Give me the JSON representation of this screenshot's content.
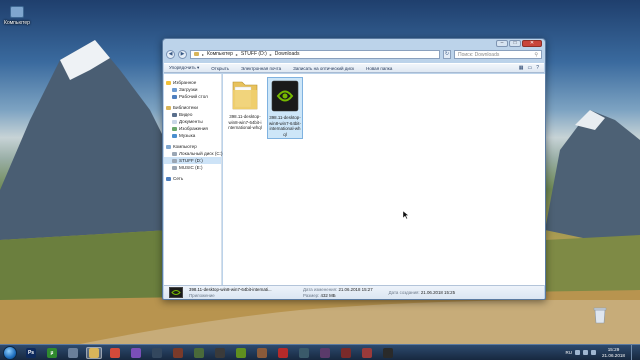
{
  "desktop": {
    "icons": [
      {
        "label": "Компьютер",
        "icon": "computer-icon"
      }
    ],
    "recycle_bin": {
      "icon": "recycle-bin-icon"
    }
  },
  "window": {
    "breadcrumbs": [
      "Компьютер",
      "STUFF (D:)",
      "Downloads"
    ],
    "search_placeholder": "Поиск: Downloads",
    "toolbar": {
      "organize": "Упорядочить ▾",
      "open": "Открыть",
      "email": "Электронная почта",
      "burn": "Записать на оптический диск",
      "new_folder": "Новая папка"
    },
    "nav": {
      "favorites": "Избранное",
      "downloads": "Загрузки",
      "desktop": "Рабочий стол",
      "libraries": "Библиотеки",
      "video": "Видео",
      "documents": "Документы",
      "images": "Изображения",
      "music": "Музыка",
      "computer": "Компьютер",
      "local_disk": "Локальный диск (C:)",
      "stuff": "STUFF (D:)",
      "music_drive": "MUSIC (E:)",
      "network": "Сеть"
    },
    "files": [
      {
        "name": "398.11-desktop-win8-win7-64bit-international-whql",
        "type": "folder"
      },
      {
        "name": "398.11-desktop-win8-win7-64bit-international-whql",
        "type": "nvidia-installer"
      }
    ],
    "details": {
      "name": "398.11-desktop-win8-win7-64bit-internati...",
      "type": "Приложение",
      "modified_label": "Дата изменения:",
      "modified": "21.06.2018 15:27",
      "created_label": "Дата создания:",
      "created": "21.06.2018 15:25",
      "size_label": "Размер:",
      "size": "432 МБ"
    }
  },
  "taskbar": {
    "apps": [
      {
        "icon": "photoshop-icon",
        "text": "Ps",
        "color": "#0e2a5c"
      },
      {
        "icon": "utorrent-icon",
        "text": "µ",
        "color": "#2f8a2f"
      },
      {
        "icon": "notepad-icon",
        "text": "",
        "color": "#6a7f9a"
      },
      {
        "icon": "folder-icon",
        "text": "",
        "color": "#d9b55a"
      },
      {
        "icon": "chrome-icon",
        "text": "",
        "color": "#d44a3a"
      },
      {
        "icon": "viber-icon",
        "text": "",
        "color": "#7a4fb8"
      },
      {
        "icon": "steam-icon",
        "text": "",
        "color": "#33475e"
      },
      {
        "icon": "app-icon",
        "text": "",
        "color": "#7a3a2a"
      },
      {
        "icon": "app-icon",
        "text": "",
        "color": "#4a6a3a"
      },
      {
        "icon": "app-icon",
        "text": "",
        "color": "#3a3a3a"
      },
      {
        "icon": "nvidia-icon",
        "text": "",
        "color": "#5f8f1f"
      },
      {
        "icon": "app-icon",
        "text": "",
        "color": "#8a5a3a"
      },
      {
        "icon": "app-icon",
        "text": "",
        "color": "#b52a2a"
      },
      {
        "icon": "app-icon",
        "text": "",
        "color": "#3a5a6a"
      },
      {
        "icon": "app-icon",
        "text": "",
        "color": "#5a3a6a"
      },
      {
        "icon": "app-icon",
        "text": "",
        "color": "#7a2a2a"
      },
      {
        "icon": "app-icon",
        "text": "",
        "color": "#9a3a3a"
      },
      {
        "icon": "app-icon",
        "text": "",
        "color": "#2a2a2a"
      }
    ],
    "tray": {
      "lang": "RU"
    },
    "clock": {
      "time": "15:29",
      "date": "21.06.2018"
    }
  }
}
